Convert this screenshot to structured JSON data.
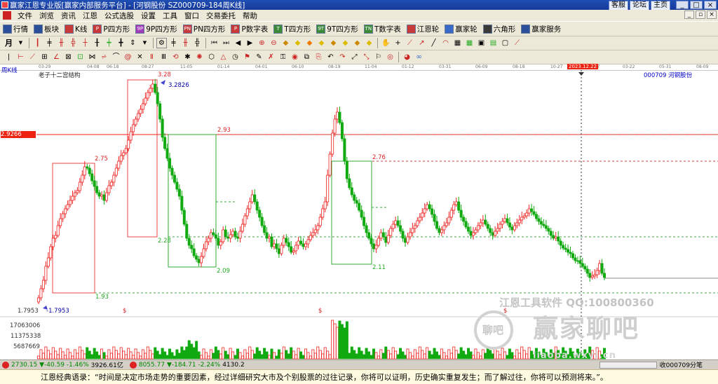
{
  "window": {
    "title": "赢家江恩专业版[赢家内部服务平台] - [河钢股份  SZ000709-184周K线]",
    "links": [
      "客服",
      "论坛",
      "主页"
    ],
    "buttons": [
      "_",
      "□",
      "×"
    ]
  },
  "menu": [
    "文件",
    "浏览",
    "资讯",
    "江恩",
    "公式选股",
    "设置",
    "工具",
    "窗口",
    "交易委托",
    "帮助"
  ],
  "toolbar1": [
    {
      "label": "行情",
      "icon": "table-icon",
      "color": "#2b4f9a"
    },
    {
      "label": "板块",
      "icon": "blocks-icon",
      "color": "#2b4f9a"
    },
    {
      "label": "K线",
      "icon": "kline-icon",
      "color": "#c83a3a"
    },
    {
      "label": "P四方形",
      "icon": "p-square-icon",
      "color": "#c83a3a",
      "abbr": "P"
    },
    {
      "label": "9P四方形",
      "icon": "9p-square-icon",
      "color": "#a03ab8",
      "abbr": "9P"
    },
    {
      "label": "PN四方形",
      "icon": "pn-square-icon",
      "color": "#c83a3a",
      "abbr": "PN"
    },
    {
      "label": "P数字表",
      "icon": "p-number-table-icon",
      "color": "#c83a3a",
      "abbr": "P"
    },
    {
      "label": "T四方形",
      "icon": "t-square-icon",
      "color": "#3a8a3a",
      "abbr": "T"
    },
    {
      "label": "9T四方形",
      "icon": "9t-square-icon",
      "color": "#3a8a3a",
      "abbr": "9T"
    },
    {
      "label": "T数字表",
      "icon": "t-number-table-icon",
      "color": "#3a8a3a",
      "abbr": "TN"
    },
    {
      "label": "江恩轮",
      "icon": "gann-wheel-icon",
      "color": "#c83a3a"
    },
    {
      "label": "赢家轮",
      "icon": "winner-wheel-icon",
      "color": "#3a6ac8"
    },
    {
      "label": "六角形",
      "icon": "hexagon-icon",
      "color": "#3a3a3a"
    },
    {
      "label": "赢家服务",
      "icon": "winner-service-icon",
      "color": "#2b4f9a"
    }
  ],
  "chart": {
    "period_label": "周K线",
    "study_title": "老子十二宫结构",
    "stock_label": "000709  河钢股份",
    "highlight_date": "2023.12.22",
    "price_box": "2.9266",
    "dates": [
      "03-29",
      "04-08",
      "06-18",
      "08-27",
      "11-05",
      "01-14",
      "04-01",
      "06-10",
      "08-19",
      "11-04",
      "01-12",
      "03-31",
      "06-09",
      "08-18",
      "10-27",
      "01-17",
      "03-22",
      "05-31",
      "08-09"
    ],
    "price_labels": {
      "p328": "3.28",
      "p32826": "3.2826",
      "p293": "2.93",
      "p276": "2.76",
      "p275": "2.75",
      "p228": "2.28",
      "p211": "2.11",
      "p209": "2.09",
      "p193": "1.93",
      "low1": "1.7953",
      "low2": "-1.7953",
      "markers": [
        "$",
        "$",
        "$"
      ]
    },
    "volume_axis": [
      "17063006",
      "11375338",
      "5687669"
    ],
    "watermark_line1": "江恩工具软件  QQ:100800360",
    "watermark_line2": "赢家聊吧",
    "watermark_logo": "聊吧",
    "watermark_url": "liaoba.wxyj.cn"
  },
  "statusbar": {
    "sh": {
      "index": "2730.15",
      "chg": "▼-40.59",
      "pct": "-1.46%",
      "amount": "3926.61亿"
    },
    "sz": {
      "index": "8055.77",
      "chg": "▼-184.71",
      "pct": "-2.24%",
      "amount": "4130.2"
    },
    "right": "收000709分笔"
  },
  "quote": "江恩经典语录：“时间是决定市场走势的重要因素，经过详细研究大市及个别股票的过往记录，你将可以证明，历史确实重复发生；而了解过往，你将可以预测将来。”。"
}
